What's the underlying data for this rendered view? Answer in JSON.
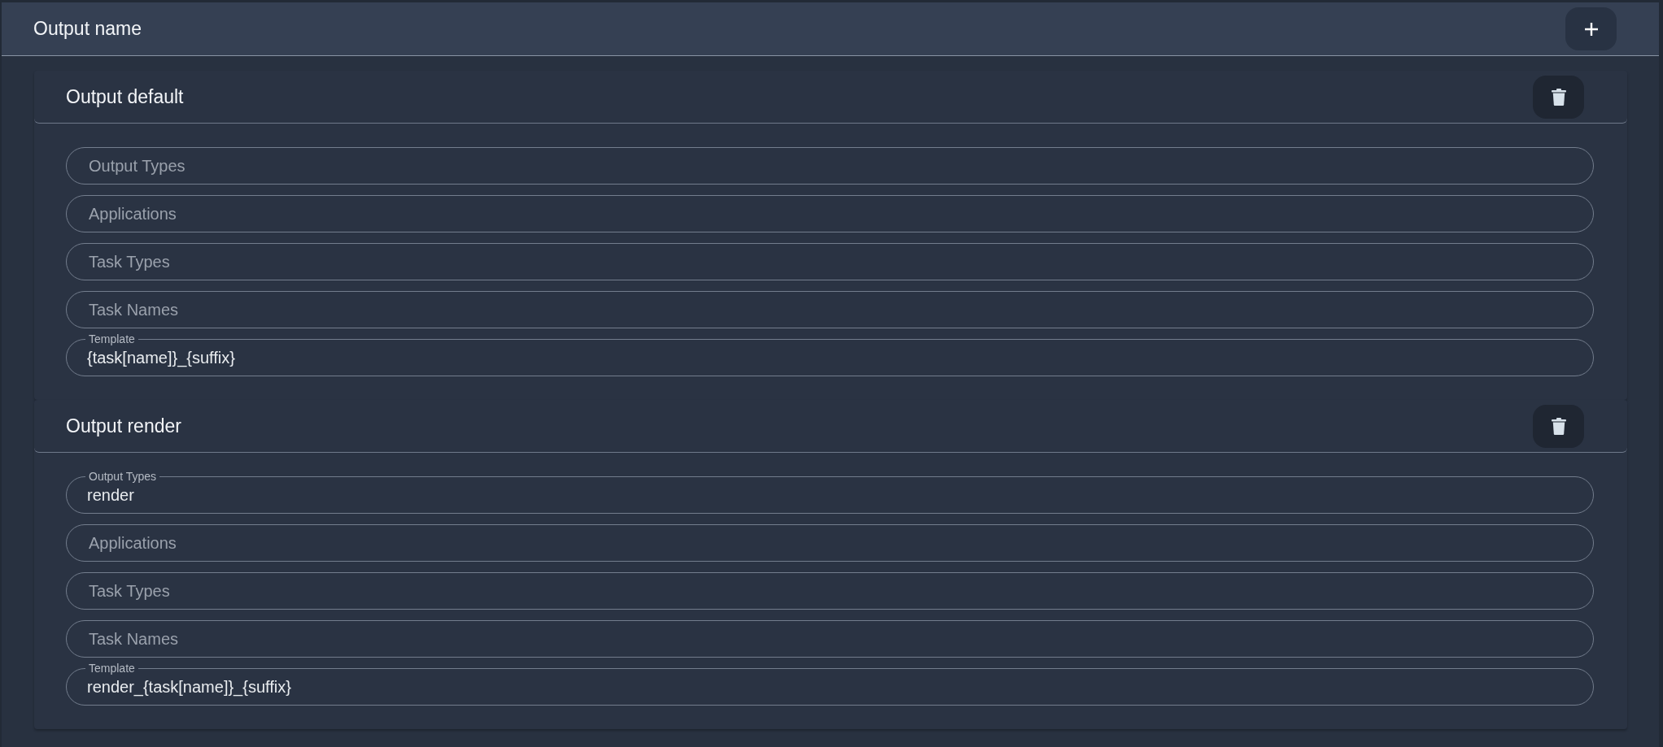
{
  "panel": {
    "title": "Output name"
  },
  "outputs": [
    {
      "title": "Output default",
      "fields": [
        {
          "label": "Output Types"
        },
        {
          "label": "Applications"
        },
        {
          "label": "Task Types"
        },
        {
          "label": "Task Names"
        },
        {
          "label": "Template",
          "value": "{task[name]}_{suffix}"
        }
      ]
    },
    {
      "title": "Output render",
      "fields": [
        {
          "label": "Output Types",
          "value": "render"
        },
        {
          "label": "Applications"
        },
        {
          "label": "Task Types"
        },
        {
          "label": "Task Names"
        },
        {
          "label": "Template",
          "value": "render_{task[name]}_{suffix}"
        }
      ]
    }
  ]
}
